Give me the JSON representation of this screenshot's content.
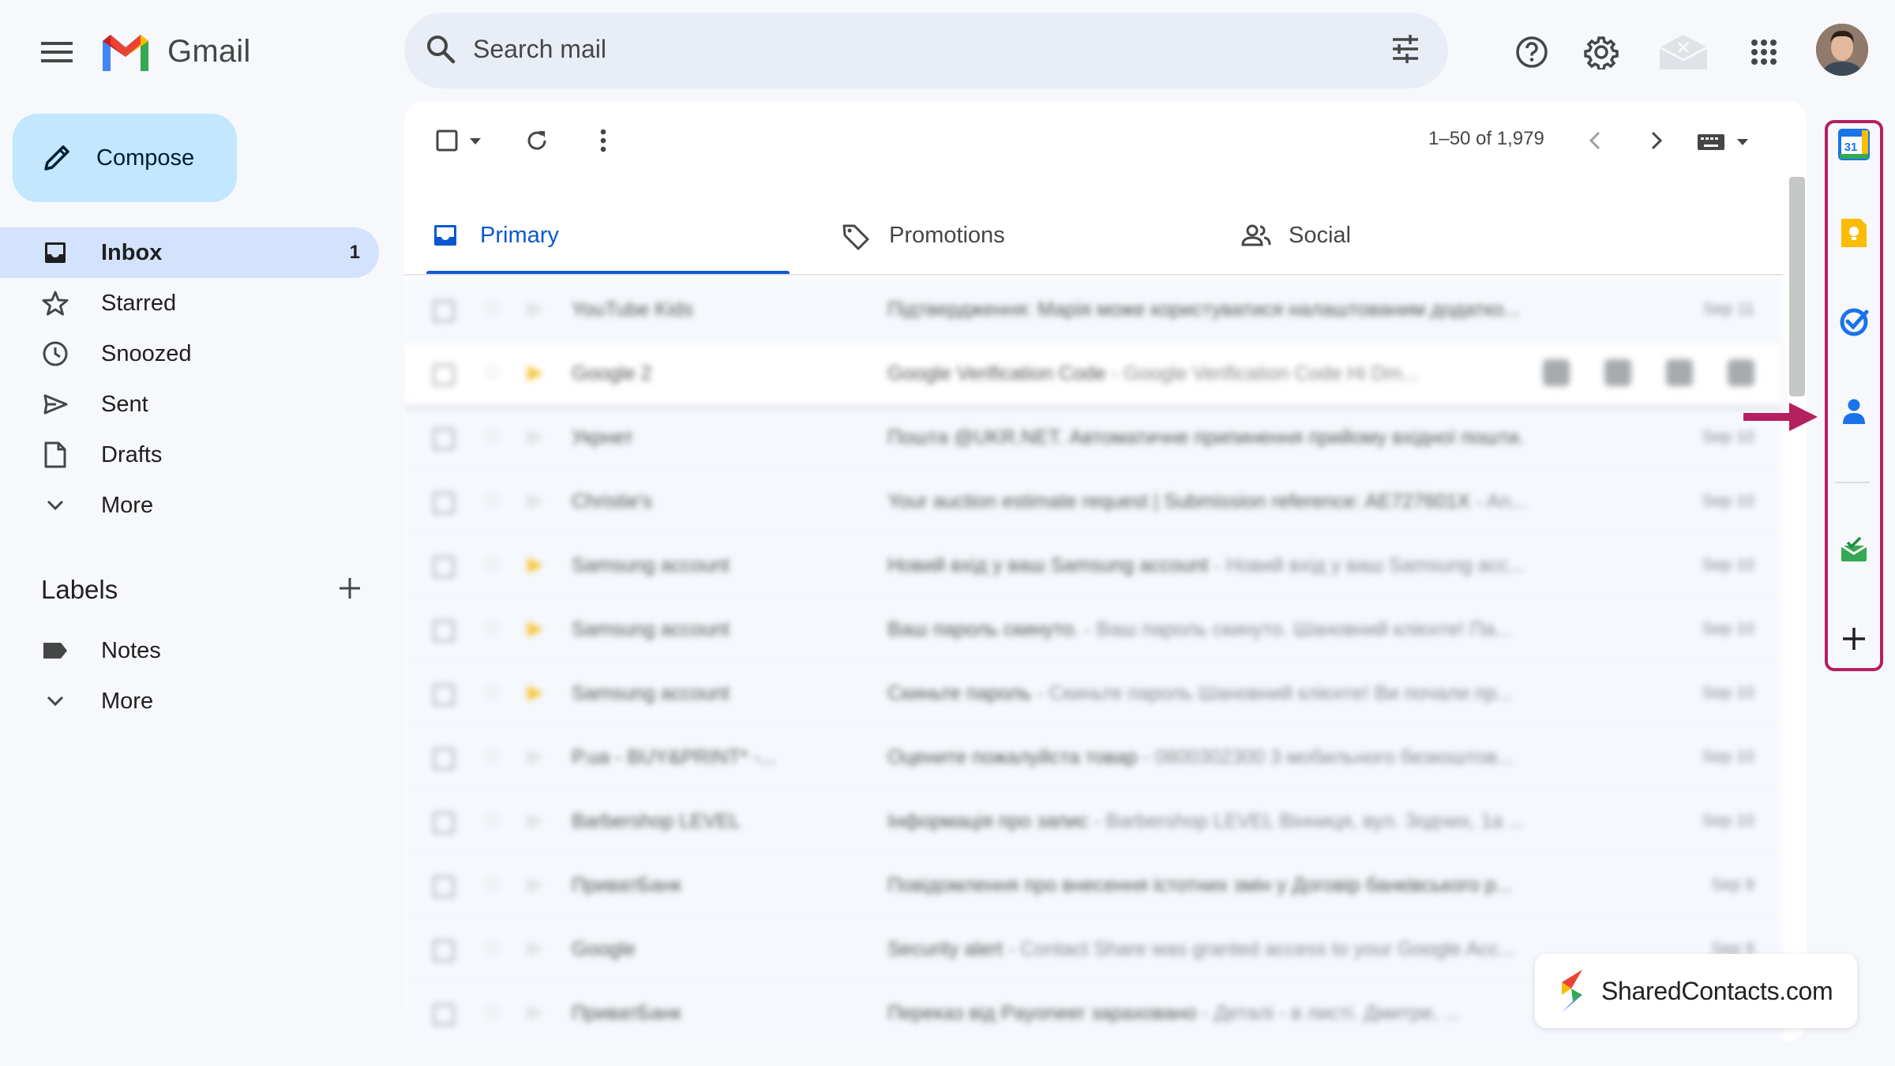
{
  "app": {
    "name": "Gmail"
  },
  "search": {
    "placeholder": "Search mail"
  },
  "compose": {
    "label": "Compose"
  },
  "nav": [
    {
      "label": "Inbox",
      "count": "1",
      "icon": "inbox-icon"
    },
    {
      "label": "Starred",
      "icon": "star-icon"
    },
    {
      "label": "Snoozed",
      "icon": "clock-icon"
    },
    {
      "label": "Sent",
      "icon": "send-icon"
    },
    {
      "label": "Drafts",
      "icon": "draft-icon"
    },
    {
      "label": "More",
      "icon": "chevron-down-icon"
    }
  ],
  "labels": {
    "title": "Labels",
    "items": [
      {
        "label": "Notes"
      }
    ],
    "more": "More"
  },
  "toolbar": {
    "pagination": "1–50 of 1,979"
  },
  "tabs": [
    {
      "label": "Primary",
      "icon": "inbox-icon",
      "active": true
    },
    {
      "label": "Promotions",
      "icon": "tag-icon"
    },
    {
      "label": "Social",
      "icon": "people-icon"
    }
  ],
  "emails": [
    {
      "sender": "YouTube Kids",
      "subject": "Підтвердження: Марія може користуватися налаштованим додатко...",
      "snippet": "",
      "date": "Sep 11",
      "important": false,
      "unread": false
    },
    {
      "sender": "Google 2",
      "subject": "Google Verification Code",
      "snippet": " - Google Verification Code Hi Dm...",
      "date": "",
      "important": true,
      "unread": false,
      "hovered": true
    },
    {
      "sender": "Укрнет",
      "subject": "Пошта @UKR.NET. Автоматичне припинення прийому вхідної пошти.",
      "snippet": "",
      "date": "Sep 10",
      "important": false,
      "unread": false
    },
    {
      "sender": "Christie's",
      "subject": "Your auction estimate request | Submission reference: AE727601X",
      "snippet": " - An...",
      "date": "Sep 10",
      "important": false,
      "unread": false
    },
    {
      "sender": "Samsung account",
      "subject": "Новий вхід у ваш Samsung account",
      "snippet": " - Новий вхід у ваш Samsung acc...",
      "date": "Sep 10",
      "important": true,
      "unread": false
    },
    {
      "sender": "Samsung account",
      "subject": "Ваш пароль скинуто.",
      "snippet": " - Ваш пароль скинуто. Шановний клієнте! Па...",
      "date": "Sep 10",
      "important": true,
      "unread": false
    },
    {
      "sender": "Samsung account",
      "subject": "Скиньте пароль",
      "snippet": " - Скиньте пароль Шановний клієнте! Ви почали пр...",
      "date": "Sep 10",
      "important": true,
      "unread": false
    },
    {
      "sender": "P.ua - BUY&PRINT* -...",
      "subject": "Оцените пожалуйста товар",
      "snippet": " - 0800302300 3 мобильного безкоштов...",
      "date": "Sep 10",
      "important": false,
      "unread": false
    },
    {
      "sender": "Barbershop LEVEL",
      "subject": "Інформація про запис",
      "snippet": " - Barbershop LEVEL Вінниця, вул. Зодчих, 1а ...",
      "date": "Sep 10",
      "important": false,
      "unread": false
    },
    {
      "sender": "ПриватБанк",
      "subject": "Повідомлення про внесення істотних змін у Договір банківського р...",
      "snippet": "",
      "date": "Sep 9",
      "important": false,
      "unread": false
    },
    {
      "sender": "Google",
      "subject": "Security alert",
      "snippet": " - Contact Share was granted access to your Google Acc...",
      "date": "Sep 9",
      "important": false,
      "unread": false
    },
    {
      "sender": "ПриватБанк",
      "subject": "Переказ від Payoneer зараховано",
      "snippet": " - Деталі - в листі. Дмитре, ...",
      "date": "",
      "important": false,
      "unread": false
    }
  ],
  "side_panel": [
    {
      "name": "calendar-icon",
      "text": "31",
      "color": "#1a73e8"
    },
    {
      "name": "keep-icon",
      "color": "#fbbc04"
    },
    {
      "name": "tasks-icon",
      "color": "#1a73e8"
    },
    {
      "name": "contacts-icon",
      "color": "#1a73e8"
    },
    {
      "name": "addon-icon",
      "color": "#34a853"
    },
    {
      "name": "add-icon",
      "color": "#1f1f1f"
    }
  ],
  "colors": {
    "highlight": "#b5205f",
    "accent": "#0b57d0"
  },
  "watermark": {
    "text": "SharedContacts.com"
  }
}
